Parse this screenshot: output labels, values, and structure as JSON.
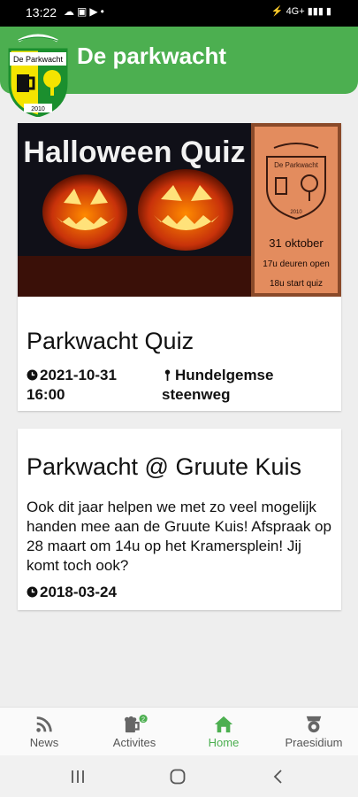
{
  "status_bar": {
    "time": "13:22",
    "left_icons": [
      "cloud-icon",
      "image-icon",
      "youtube-icon",
      "dot-icon"
    ],
    "right_icons": "⚡ 4G+ ▮▮▮ ▮"
  },
  "app_bar": {
    "title": "De parkwacht",
    "logo_text": "De Parkwacht",
    "logo_year": "2010"
  },
  "events": [
    {
      "banner": {
        "headline": "Halloween Quiz",
        "logo_text": "De Parkwacht",
        "logo_year": "2010",
        "date": "31 oktober",
        "line1": "17u deuren open",
        "line2": "18u start quiz"
      },
      "title": "Parkwacht Quiz",
      "datetime_line1": "2021-10-31",
      "datetime_line2": "16:00",
      "location_line1": "Hundelgemse",
      "location_line2": "steenweg"
    },
    {
      "title": "Parkwacht @ Gruute Kuis",
      "description": "Ook dit jaar helpen we met zo veel mogelijk handen mee aan de Gruute Kuis! Afspraak op 28 maart om 14u op het Kramersplein! Jij komt toch ook?",
      "date": "2018-03-24"
    }
  ],
  "bottom_nav": [
    {
      "label": "News",
      "icon": "rss-icon"
    },
    {
      "label": "Activites",
      "icon": "beer-icon",
      "badge": "2"
    },
    {
      "label": "Home",
      "icon": "home-icon",
      "active": true
    },
    {
      "label": "Praesidium",
      "icon": "medal-icon"
    }
  ],
  "colors": {
    "primary": "#4caf50",
    "active_nav": "#4caf50",
    "badge": "#4caf50",
    "logo_yellow": "#f4e400",
    "logo_green": "#1b8f2e"
  }
}
